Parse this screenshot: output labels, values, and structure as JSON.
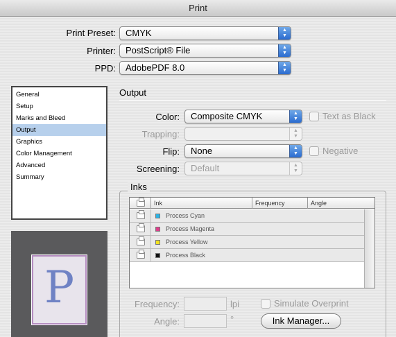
{
  "window": {
    "title": "Print"
  },
  "top": {
    "preset_label": "Print Preset:",
    "preset_value": "CMYK",
    "printer_label": "Printer:",
    "printer_value": "PostScript® File",
    "ppd_label": "PPD:",
    "ppd_value": "AdobePDF 8.0"
  },
  "sidebar": {
    "items": [
      "General",
      "Setup",
      "Marks and Bleed",
      "Output",
      "Graphics",
      "Color Management",
      "Advanced",
      "Summary"
    ],
    "selected": "Output"
  },
  "preview": {
    "letter": "P"
  },
  "output": {
    "title": "Output",
    "color_label": "Color:",
    "color_value": "Composite CMYK",
    "text_as_black_label": "Text as Black",
    "trapping_label": "Trapping:",
    "trapping_value": "",
    "flip_label": "Flip:",
    "flip_value": "None",
    "negative_label": "Negative",
    "screening_label": "Screening:",
    "screening_value": "Default"
  },
  "inks": {
    "title": "Inks",
    "columns": [
      "Ink",
      "Frequency",
      "Angle"
    ],
    "rows": [
      {
        "name": "Process Cyan",
        "color": "#2ab4e6"
      },
      {
        "name": "Process Magenta",
        "color": "#e03c8c"
      },
      {
        "name": "Process Yellow",
        "color": "#f2e21e"
      },
      {
        "name": "Process Black",
        "color": "#111111"
      }
    ],
    "frequency_label": "Frequency:",
    "frequency_unit": "lpi",
    "angle_label": "Angle:",
    "angle_unit": "°",
    "simulate_overprint_label": "Simulate Overprint",
    "ink_manager_label": "Ink Manager..."
  },
  "icons": {
    "popup_arrows": "up-down-arrows-icon",
    "printer": "printer-icon"
  }
}
